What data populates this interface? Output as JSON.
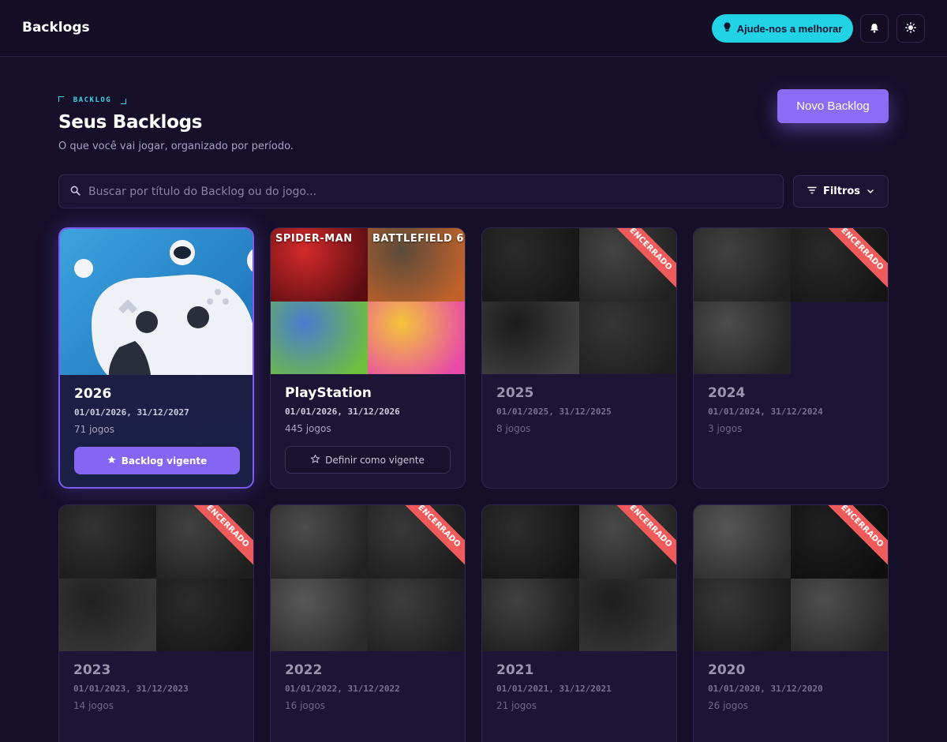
{
  "app": {
    "title": "Backlogs"
  },
  "topbar": {
    "help_label": "Ajude-nos a melhorar",
    "icons": [
      "lightbulb-icon",
      "bell-icon",
      "sun-icon"
    ]
  },
  "header": {
    "eyebrow": "BACKLOG",
    "title": "Seus Backlogs",
    "subtitle": "O que você vai jogar, organizado por período.",
    "new_button": "Novo Backlog"
  },
  "search": {
    "placeholder": "Buscar por título do Backlog ou do jogo...",
    "value": ""
  },
  "filters": {
    "label": "Filtros"
  },
  "colors": {
    "accent": "#8b6cf6",
    "cyan": "#22d3e6",
    "ended_ribbon": "#ef5a5a",
    "background": "#150f2a"
  },
  "cards": [
    {
      "title": "2026",
      "dates": "01/01/2026, 31/12/2027",
      "count": "71 jogos",
      "state": "current",
      "button": "Backlog vigente",
      "ribbon": "",
      "tiles": [
        {
          "c1": "#3da3de",
          "c2": "#1a6fb8"
        }
      ]
    },
    {
      "title": "PlayStation",
      "dates": "01/01/2026, 31/12/2026",
      "count": "445 jogos",
      "state": "active",
      "button": "Definir como vigente",
      "ribbon": "",
      "tiles": [
        {
          "label": "SPIDER-MAN",
          "c1": "#d42a2a",
          "c2": "#5b0d12"
        },
        {
          "label": "BATTLEFIELD 6",
          "c1": "#5a4a3a",
          "c2": "#c2622a"
        },
        {
          "label": "",
          "c1": "#4a7bd0",
          "c2": "#6fbf3e"
        },
        {
          "label": "",
          "c1": "#f4c53a",
          "c2": "#e84aa8"
        }
      ]
    },
    {
      "title": "2025",
      "dates": "01/01/2025, 31/12/2025",
      "count": "8 jogos",
      "state": "ended",
      "button": "",
      "ribbon": "ENCERRADO",
      "tiles": [
        {
          "c1": "#3b3b3b",
          "c2": "#1e1e1e"
        },
        {
          "c1": "#5e5e5e",
          "c2": "#2e2e2e"
        },
        {
          "c1": "#262626",
          "c2": "#5a5a5a"
        },
        {
          "c1": "#4a4a4a",
          "c2": "#2a2a2a"
        }
      ]
    },
    {
      "title": "2024",
      "dates": "01/01/2024, 31/12/2024",
      "count": "3 jogos",
      "state": "ended",
      "button": "",
      "ribbon": "ENCERRADO",
      "tiles": [
        {
          "c1": "#5a5a5a",
          "c2": "#2c2c2c"
        },
        {
          "c1": "#3a3a3a",
          "c2": "#1c1c1c"
        },
        {
          "c1": "#6a6a6a",
          "c2": "#303030"
        }
      ]
    },
    {
      "title": "2023",
      "dates": "01/01/2023, 31/12/2023",
      "count": "14 jogos",
      "state": "ended",
      "button": "",
      "ribbon": "ENCERRADO",
      "tiles": [
        {
          "c1": "#464646",
          "c2": "#222222"
        },
        {
          "c1": "#5a5a5a",
          "c2": "#2a2a2a"
        },
        {
          "c1": "#2e2e2e",
          "c2": "#4e4e4e"
        },
        {
          "c1": "#3c3c3c",
          "c2": "#1e1e1e"
        }
      ]
    },
    {
      "title": "2022",
      "dates": "01/01/2022, 31/12/2022",
      "count": "16 jogos",
      "state": "ended",
      "button": "",
      "ribbon": "ENCERRADO",
      "tiles": [
        {
          "c1": "#6a6a6a",
          "c2": "#2e2e2e"
        },
        {
          "c1": "#4e4e4e",
          "c2": "#262626"
        },
        {
          "c1": "#7a7a7a",
          "c2": "#3a3a3a"
        },
        {
          "c1": "#555555",
          "c2": "#2a2a2a"
        }
      ]
    },
    {
      "title": "2021",
      "dates": "01/01/2021, 31/12/2021",
      "count": "21 jogos",
      "state": "ended",
      "button": "",
      "ribbon": "ENCERRADO",
      "tiles": [
        {
          "c1": "#3e3e3e",
          "c2": "#1c1c1c"
        },
        {
          "c1": "#666666",
          "c2": "#2e2e2e"
        },
        {
          "c1": "#5a5a5a",
          "c2": "#262626"
        },
        {
          "c1": "#2a2a2a",
          "c2": "#4c4c4c"
        }
      ]
    },
    {
      "title": "2020",
      "dates": "01/01/2020, 31/12/2020",
      "count": "26 jogos",
      "state": "ended",
      "button": "",
      "ribbon": "ENCERRADO",
      "tiles": [
        {
          "c1": "#777777",
          "c2": "#3a3a3a"
        },
        {
          "c1": "#2c2c2c",
          "c2": "#141414"
        },
        {
          "c1": "#4c4c4c",
          "c2": "#242424"
        },
        {
          "c1": "#6c6c6c",
          "c2": "#343434"
        }
      ]
    }
  ]
}
